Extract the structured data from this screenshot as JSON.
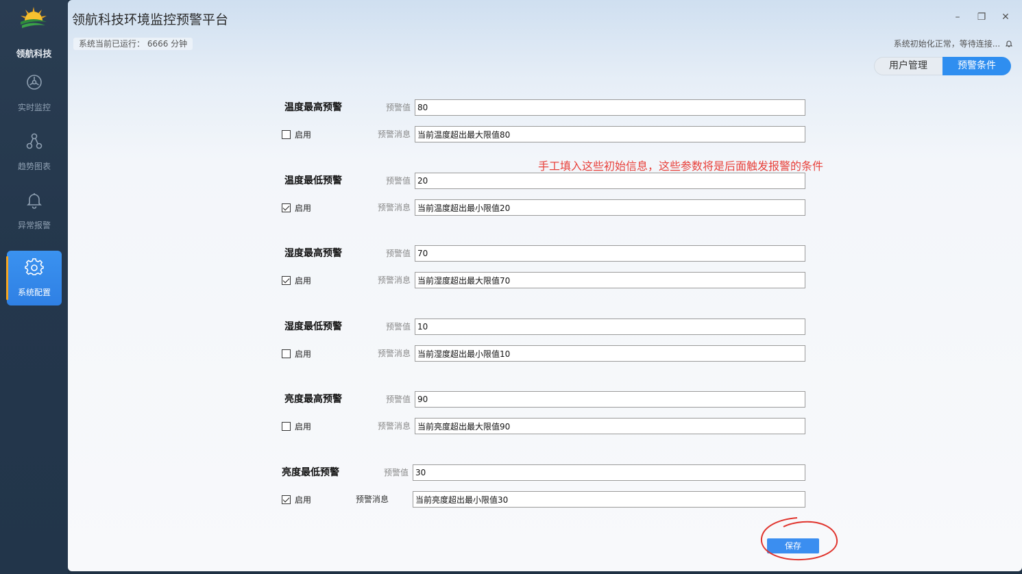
{
  "sidebar": {
    "brand": "领航科技",
    "items": [
      {
        "label": "实时监控",
        "icon": "dashboard-icon"
      },
      {
        "label": "趋势图表",
        "icon": "chart-nodes-icon"
      },
      {
        "label": "异常报警",
        "icon": "bell-icon"
      },
      {
        "label": "系统配置",
        "icon": "gear-icon",
        "active": true
      }
    ]
  },
  "window": {
    "title": "领航科技环境监控预警平台",
    "controls": {
      "minimize": "–",
      "restore": "❐",
      "close": "✕"
    }
  },
  "status": {
    "runtime": "系统当前已运行：  6666 分钟",
    "connection": "系统初始化正常，等待连接..."
  },
  "tabs": [
    {
      "label": "用户管理",
      "active": false
    },
    {
      "label": "预警条件",
      "active": true
    }
  ],
  "annotation": "手工填入这些初始信息，这些参数将是后面触发报警的条件",
  "form": {
    "value_label": "预警值",
    "message_label": "预警消息",
    "enable_label": "启用",
    "rules": [
      {
        "title": "温度最高预警",
        "value": "80",
        "message": "当前温度超出最大限值80",
        "enabled": false
      },
      {
        "title": "温度最低预警",
        "value": "20",
        "message": "当前温度超出最小限值20",
        "enabled": true
      },
      {
        "title": "湿度最高预警",
        "value": "70",
        "message": "当前湿度超出最大限值70",
        "enabled": true
      },
      {
        "title": "湿度最低预警",
        "value": "10",
        "message": "当前湿度超出最小限值10",
        "enabled": false
      },
      {
        "title": "亮度最高预警",
        "value": "90",
        "message": "当前亮度超出最大限值90",
        "enabled": false
      },
      {
        "title": "亮度最低预警",
        "value": "30",
        "message": "当前亮度超出最小限值30",
        "enabled": true
      }
    ]
  },
  "save_label": "保存",
  "colors": {
    "accent": "#2f8ef0",
    "annotation": "#e8413b",
    "sidebar": "#24374c",
    "warning_stripe": "#f5a623"
  }
}
